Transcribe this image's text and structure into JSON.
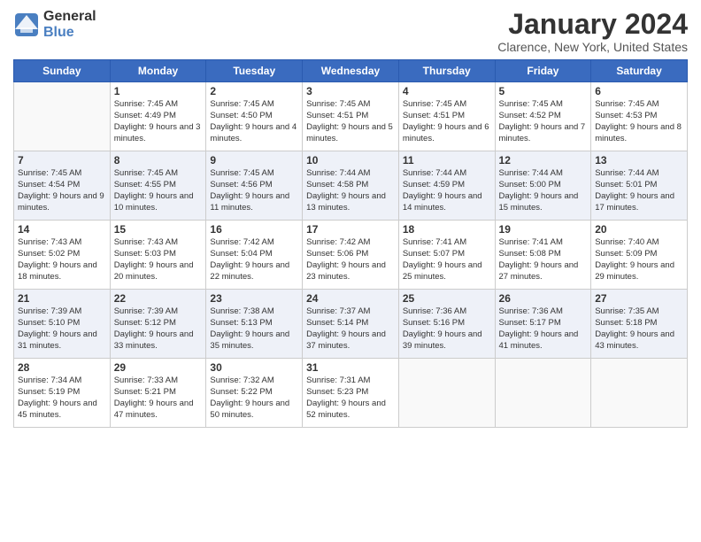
{
  "logo": {
    "general": "General",
    "blue": "Blue"
  },
  "title": "January 2024",
  "subtitle": "Clarence, New York, United States",
  "headers": [
    "Sunday",
    "Monday",
    "Tuesday",
    "Wednesday",
    "Thursday",
    "Friday",
    "Saturday"
  ],
  "weeks": [
    [
      {
        "num": "",
        "sr": "",
        "ss": "",
        "dl": ""
      },
      {
        "num": "1",
        "sr": "Sunrise: 7:45 AM",
        "ss": "Sunset: 4:49 PM",
        "dl": "Daylight: 9 hours and 3 minutes."
      },
      {
        "num": "2",
        "sr": "Sunrise: 7:45 AM",
        "ss": "Sunset: 4:50 PM",
        "dl": "Daylight: 9 hours and 4 minutes."
      },
      {
        "num": "3",
        "sr": "Sunrise: 7:45 AM",
        "ss": "Sunset: 4:51 PM",
        "dl": "Daylight: 9 hours and 5 minutes."
      },
      {
        "num": "4",
        "sr": "Sunrise: 7:45 AM",
        "ss": "Sunset: 4:51 PM",
        "dl": "Daylight: 9 hours and 6 minutes."
      },
      {
        "num": "5",
        "sr": "Sunrise: 7:45 AM",
        "ss": "Sunset: 4:52 PM",
        "dl": "Daylight: 9 hours and 7 minutes."
      },
      {
        "num": "6",
        "sr": "Sunrise: 7:45 AM",
        "ss": "Sunset: 4:53 PM",
        "dl": "Daylight: 9 hours and 8 minutes."
      }
    ],
    [
      {
        "num": "7",
        "sr": "Sunrise: 7:45 AM",
        "ss": "Sunset: 4:54 PM",
        "dl": "Daylight: 9 hours and 9 minutes."
      },
      {
        "num": "8",
        "sr": "Sunrise: 7:45 AM",
        "ss": "Sunset: 4:55 PM",
        "dl": "Daylight: 9 hours and 10 minutes."
      },
      {
        "num": "9",
        "sr": "Sunrise: 7:45 AM",
        "ss": "Sunset: 4:56 PM",
        "dl": "Daylight: 9 hours and 11 minutes."
      },
      {
        "num": "10",
        "sr": "Sunrise: 7:44 AM",
        "ss": "Sunset: 4:58 PM",
        "dl": "Daylight: 9 hours and 13 minutes."
      },
      {
        "num": "11",
        "sr": "Sunrise: 7:44 AM",
        "ss": "Sunset: 4:59 PM",
        "dl": "Daylight: 9 hours and 14 minutes."
      },
      {
        "num": "12",
        "sr": "Sunrise: 7:44 AM",
        "ss": "Sunset: 5:00 PM",
        "dl": "Daylight: 9 hours and 15 minutes."
      },
      {
        "num": "13",
        "sr": "Sunrise: 7:44 AM",
        "ss": "Sunset: 5:01 PM",
        "dl": "Daylight: 9 hours and 17 minutes."
      }
    ],
    [
      {
        "num": "14",
        "sr": "Sunrise: 7:43 AM",
        "ss": "Sunset: 5:02 PM",
        "dl": "Daylight: 9 hours and 18 minutes."
      },
      {
        "num": "15",
        "sr": "Sunrise: 7:43 AM",
        "ss": "Sunset: 5:03 PM",
        "dl": "Daylight: 9 hours and 20 minutes."
      },
      {
        "num": "16",
        "sr": "Sunrise: 7:42 AM",
        "ss": "Sunset: 5:04 PM",
        "dl": "Daylight: 9 hours and 22 minutes."
      },
      {
        "num": "17",
        "sr": "Sunrise: 7:42 AM",
        "ss": "Sunset: 5:06 PM",
        "dl": "Daylight: 9 hours and 23 minutes."
      },
      {
        "num": "18",
        "sr": "Sunrise: 7:41 AM",
        "ss": "Sunset: 5:07 PM",
        "dl": "Daylight: 9 hours and 25 minutes."
      },
      {
        "num": "19",
        "sr": "Sunrise: 7:41 AM",
        "ss": "Sunset: 5:08 PM",
        "dl": "Daylight: 9 hours and 27 minutes."
      },
      {
        "num": "20",
        "sr": "Sunrise: 7:40 AM",
        "ss": "Sunset: 5:09 PM",
        "dl": "Daylight: 9 hours and 29 minutes."
      }
    ],
    [
      {
        "num": "21",
        "sr": "Sunrise: 7:39 AM",
        "ss": "Sunset: 5:10 PM",
        "dl": "Daylight: 9 hours and 31 minutes."
      },
      {
        "num": "22",
        "sr": "Sunrise: 7:39 AM",
        "ss": "Sunset: 5:12 PM",
        "dl": "Daylight: 9 hours and 33 minutes."
      },
      {
        "num": "23",
        "sr": "Sunrise: 7:38 AM",
        "ss": "Sunset: 5:13 PM",
        "dl": "Daylight: 9 hours and 35 minutes."
      },
      {
        "num": "24",
        "sr": "Sunrise: 7:37 AM",
        "ss": "Sunset: 5:14 PM",
        "dl": "Daylight: 9 hours and 37 minutes."
      },
      {
        "num": "25",
        "sr": "Sunrise: 7:36 AM",
        "ss": "Sunset: 5:16 PM",
        "dl": "Daylight: 9 hours and 39 minutes."
      },
      {
        "num": "26",
        "sr": "Sunrise: 7:36 AM",
        "ss": "Sunset: 5:17 PM",
        "dl": "Daylight: 9 hours and 41 minutes."
      },
      {
        "num": "27",
        "sr": "Sunrise: 7:35 AM",
        "ss": "Sunset: 5:18 PM",
        "dl": "Daylight: 9 hours and 43 minutes."
      }
    ],
    [
      {
        "num": "28",
        "sr": "Sunrise: 7:34 AM",
        "ss": "Sunset: 5:19 PM",
        "dl": "Daylight: 9 hours and 45 minutes."
      },
      {
        "num": "29",
        "sr": "Sunrise: 7:33 AM",
        "ss": "Sunset: 5:21 PM",
        "dl": "Daylight: 9 hours and 47 minutes."
      },
      {
        "num": "30",
        "sr": "Sunrise: 7:32 AM",
        "ss": "Sunset: 5:22 PM",
        "dl": "Daylight: 9 hours and 50 minutes."
      },
      {
        "num": "31",
        "sr": "Sunrise: 7:31 AM",
        "ss": "Sunset: 5:23 PM",
        "dl": "Daylight: 9 hours and 52 minutes."
      },
      {
        "num": "",
        "sr": "",
        "ss": "",
        "dl": ""
      },
      {
        "num": "",
        "sr": "",
        "ss": "",
        "dl": ""
      },
      {
        "num": "",
        "sr": "",
        "ss": "",
        "dl": ""
      }
    ]
  ]
}
